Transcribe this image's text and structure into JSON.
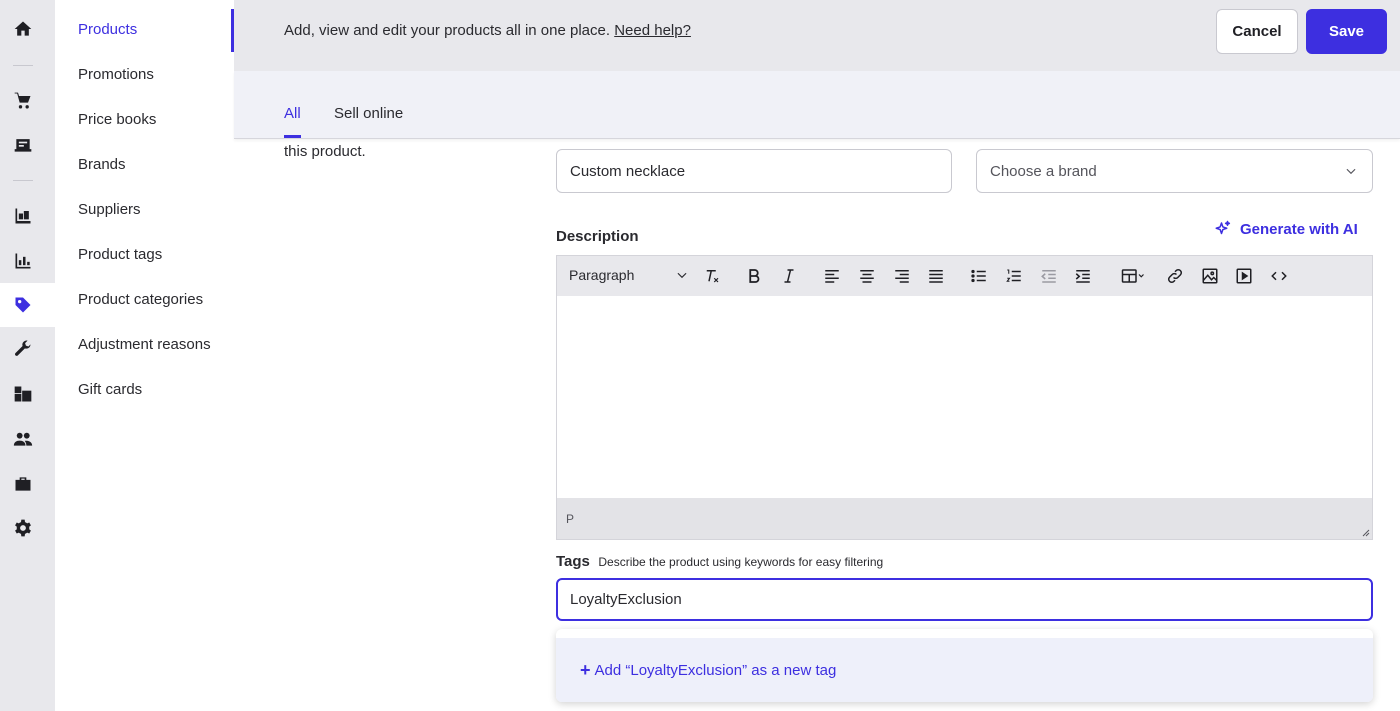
{
  "rail": {
    "icons": [
      "home-icon",
      "cart-icon",
      "register-icon",
      "inventory-icon",
      "reports-icon",
      "tag-icon",
      "wrench-icon",
      "boxes-icon",
      "customers-icon",
      "briefcase-icon",
      "gear-icon"
    ],
    "active": "tag-icon"
  },
  "subnav": {
    "items": [
      {
        "label": "Products"
      },
      {
        "label": "Promotions"
      },
      {
        "label": "Price books"
      },
      {
        "label": "Brands"
      },
      {
        "label": "Suppliers"
      },
      {
        "label": "Product tags"
      },
      {
        "label": "Product categories"
      },
      {
        "label": "Adjustment reasons"
      },
      {
        "label": "Gift cards"
      }
    ],
    "active": "Products"
  },
  "topbar": {
    "message": "Add, view and edit your products all in one place.",
    "help_link": "Need help?",
    "cancel_label": "Cancel",
    "save_label": "Save"
  },
  "tabs": {
    "items": [
      {
        "label": "All"
      },
      {
        "label": "Sell online"
      }
    ],
    "active": "All"
  },
  "form": {
    "help_text": "this product.",
    "name_value": "Custom necklace",
    "brand_placeholder": "Choose a brand",
    "description_label": "Description",
    "ai_button_label": "Generate with AI",
    "editor": {
      "block_format": "Paragraph",
      "path": "P"
    },
    "tags_label": "Tags",
    "tags_hint": "Describe the product using keywords for easy filtering",
    "tags_value": "LoyaltyExclusion",
    "add_tag_option": "Add “LoyaltyExclusion” as a new tag"
  },
  "colors": {
    "accent": "#3d2fe0",
    "rail_bg": "#e8e8ec",
    "option_bg": "#eef0fa"
  }
}
